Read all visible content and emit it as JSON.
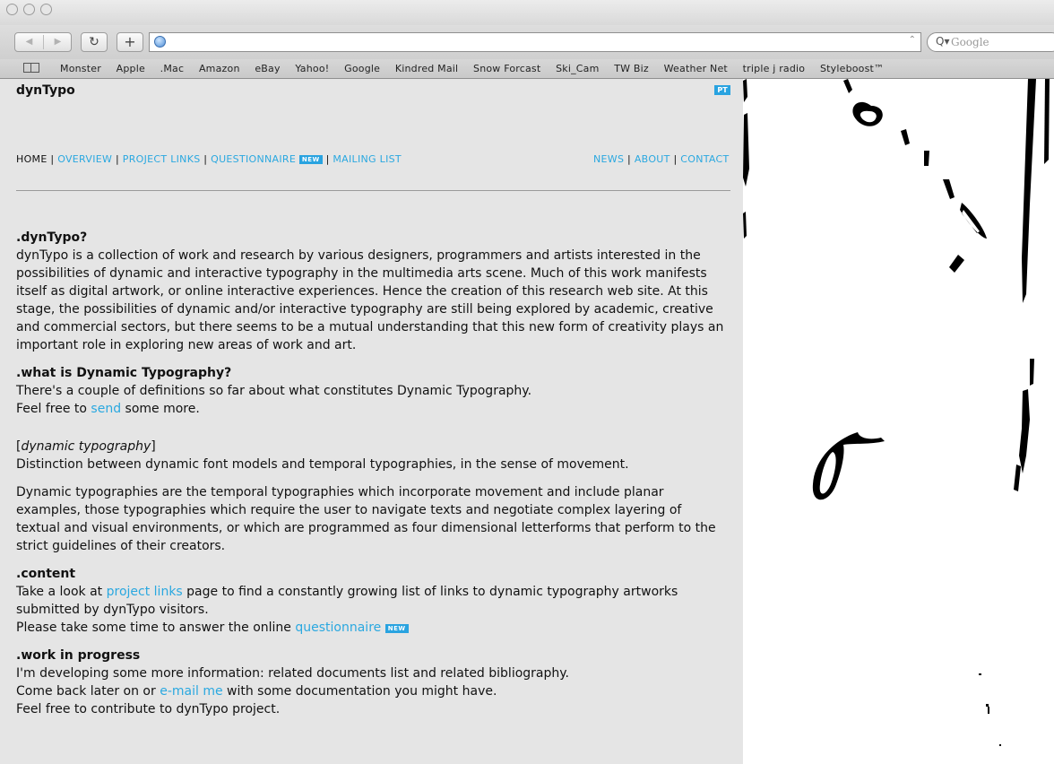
{
  "browser": {
    "search_placeholder": "Google",
    "bookmarks": [
      "Monster",
      "Apple",
      ".Mac",
      "Amazon",
      "eBay",
      "Yahoo!",
      "Google",
      "Kindred Mail",
      "Snow Forcast",
      "Ski_Cam",
      "TW Biz",
      "Weather Net",
      "triple j radio",
      "Styleboost™"
    ]
  },
  "site": {
    "logo": "dynTypo",
    "badge": "PT",
    "nav_left": {
      "home": "HOME",
      "overview": "OVERVIEW",
      "project_links": "PROJECT LINKS",
      "questionnaire": "QUESTIONNAIRE",
      "mailing_list": "MAILING LIST"
    },
    "nav_right": {
      "news": "NEWS",
      "about": "ABOUT",
      "contact": "CONTACT"
    },
    "new_badge": "NEW"
  },
  "sections": {
    "intro": {
      "heading": ".dynTypo?",
      "body": "dynTypo is a collection of work and research by various designers, programmers and artists interested in the possibilities of dynamic and interactive typography in the multimedia arts scene. Much of this work manifests itself as digital artwork, or online interactive experiences. Hence the creation of this research web site. At this stage, the possibilities of dynamic and/or interactive typography are still being explored by academic, creative and commercial sectors, but there seems to be a mutual understanding that this new form of creativity plays an important role in exploring new areas of work and art."
    },
    "what": {
      "heading": ".what is Dynamic Typography?",
      "line1": "There's a couple of definitions so far about what constitutes Dynamic Typography.",
      "line2_pre": "Feel free to ",
      "line2_link": "send",
      "line2_post": " some more.",
      "term": "dynamic typography",
      "definition": "Distinction between dynamic font models and temporal typographies, in the sense of movement.",
      "paragraph": "Dynamic typographies are the temporal typographies which incorporate movement and include planar examples, those typographies which require the user to navigate texts and negotiate complex layering of textual and visual environments, or which are programmed as four dimensional letterforms that perform to the strict guidelines of their creators."
    },
    "content": {
      "heading": ".content",
      "pre": "Take a look at ",
      "link": "project links",
      "post": " page to find a constantly growing list of links to dynamic typography artworks submitted by dynTypo visitors.",
      "q_pre": "Please take some time to answer the online ",
      "q_link": "questionnaire"
    },
    "wip": {
      "heading": ".work in progress",
      "line1": "I'm developing some more information: related documents list and related bibliography.",
      "line2_pre": "Come back later on or ",
      "line2_link": "e-mail me",
      "line2_post": " with some documentation you might have.",
      "line3": "Feel free to contribute to dynTypo project."
    }
  }
}
